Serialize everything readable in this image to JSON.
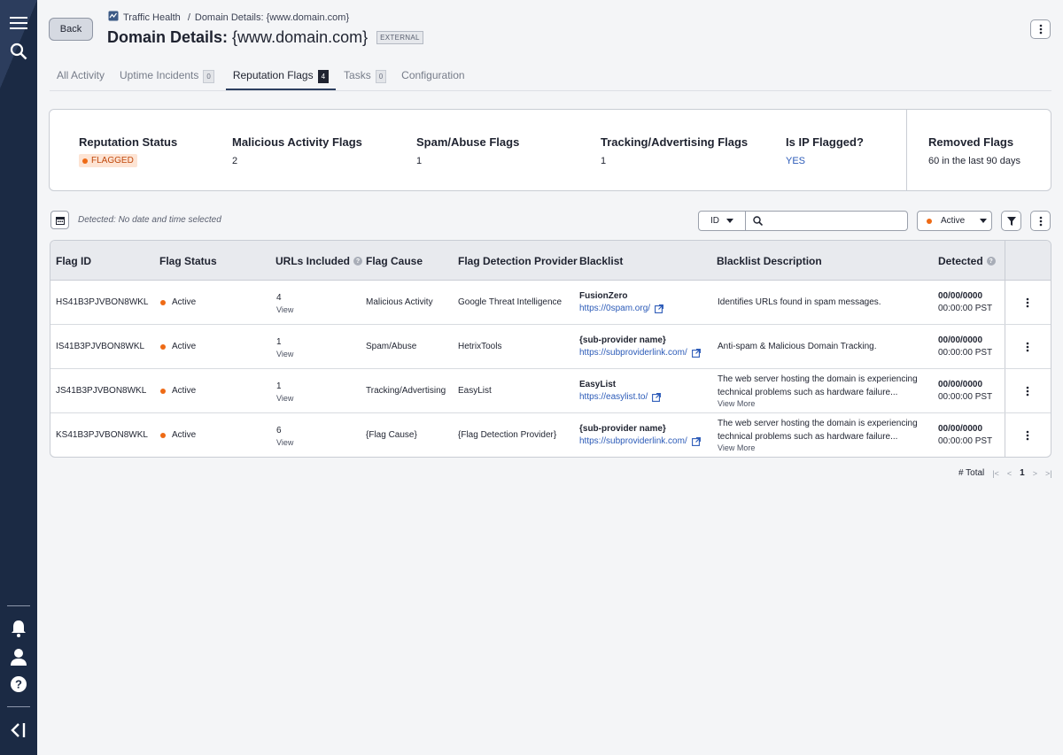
{
  "breadcrumb": {
    "parent": "Traffic Health",
    "separator": "/",
    "current": "Domain Details: {www.domain.com}"
  },
  "header": {
    "back_label": "Back",
    "title_label": "Domain Details:",
    "title_value": "{www.domain.com}",
    "badge": "EXTERNAL"
  },
  "tabs": [
    {
      "label": "All Activity",
      "count": ""
    },
    {
      "label": "Uptime Incidents",
      "count": "0"
    },
    {
      "label": "Reputation Flags",
      "count": "4"
    },
    {
      "label": "Tasks",
      "count": "0"
    },
    {
      "label": "Configuration",
      "count": ""
    }
  ],
  "summary": {
    "reputation_status": {
      "label": "Reputation Status",
      "value": "FLAGGED"
    },
    "malicious": {
      "label": "Malicious Activity Flags",
      "value": "2"
    },
    "spam": {
      "label": "Spam/Abuse Flags",
      "value": "1"
    },
    "tracking": {
      "label": "Tracking/Advertising Flags",
      "value": "1"
    },
    "ip_flagged": {
      "label": "Is IP Flagged?",
      "value": "YES"
    },
    "removed": {
      "label": "Removed Flags",
      "value": "60 in the last 90 days"
    }
  },
  "toolbar": {
    "detected_text": "Detected: No date and time selected",
    "id_select": "ID",
    "search_placeholder": "",
    "status_select": "Active"
  },
  "table": {
    "headers": {
      "flag_id": "Flag ID",
      "flag_status": "Flag Status",
      "urls": "URLs Included",
      "cause": "Flag Cause",
      "provider": "Flag Detection Provider",
      "blacklist": "Blacklist",
      "desc": "Blacklist Description",
      "detected": "Detected"
    },
    "rows": [
      {
        "id": "HS41B3PJVBON8WKL",
        "status": "Active",
        "urls": "4",
        "view": "View",
        "cause": "Malicious Activity",
        "provider": "Google Threat Intelligence",
        "bl_name": "FusionZero",
        "bl_url": "https://0spam.org/",
        "desc": "Identifies URLs found in spam messages.",
        "view_more": "",
        "date": "00/00/0000",
        "time": "00:00:00 PST"
      },
      {
        "id": "IS41B3PJVBON8WKL",
        "status": "Active",
        "urls": "1",
        "view": "View",
        "cause": "Spam/Abuse",
        "provider": "HetrixTools",
        "bl_name": "{sub-provider name}",
        "bl_url": "https://subproviderlink.com/",
        "desc": "Anti-spam & Malicious Domain Tracking.",
        "view_more": "",
        "date": "00/00/0000",
        "time": "00:00:00 PST"
      },
      {
        "id": "JS41B3PJVBON8WKL",
        "status": "Active",
        "urls": "1",
        "view": "View",
        "cause": "Tracking/Advertising",
        "provider": "EasyList",
        "bl_name": "EasyList",
        "bl_url": "https://easylist.to/",
        "desc": "The web server hosting the domain is experiencing technical problems such as hardware failure...",
        "view_more": "View More",
        "date": "00/00/0000",
        "time": "00:00:00 PST"
      },
      {
        "id": "KS41B3PJVBON8WKL",
        "status": "Active",
        "urls": "6",
        "view": "View",
        "cause": "{Flag Cause}",
        "provider": "{Flag Detection Provider}",
        "bl_name": "{sub-provider name}",
        "bl_url": "https://subproviderlink.com/",
        "desc": "The web server hosting the domain is experiencing technical problems such as hardware failure...",
        "view_more": "View More",
        "date": "00/00/0000",
        "time": "00:00:00 PST"
      }
    ]
  },
  "pager": {
    "total": "# Total",
    "page": "1"
  },
  "colors": {
    "rail": "#1b2a44",
    "accent_orange": "#ee6a15",
    "link": "#2c5bb8",
    "flag_chip_bg": "#fde4d4"
  },
  "icons": [
    "menu-icon",
    "search-icon",
    "bell-icon",
    "user-icon",
    "help-icon",
    "collapse-icon",
    "traffic-health-icon",
    "kebab-icon",
    "calendar-icon",
    "chevron-down-icon",
    "filter-icon",
    "external-link-icon"
  ]
}
